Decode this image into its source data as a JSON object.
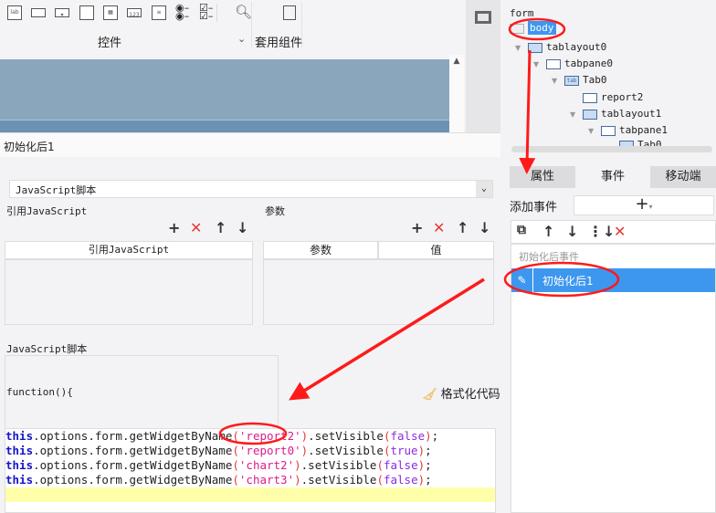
{
  "toolbar": {
    "group1_label": "控件",
    "group2_label": "套用组件",
    "icons": [
      "label-icon",
      "textbox-icon",
      "dropdown-icon",
      "panel-icon",
      "calendar-icon",
      "number-icon",
      "textarea-icon",
      "radio-group-icon",
      "checkbox-group-icon",
      "preview-icon",
      "layout-icon"
    ],
    "number_icon_text": "123",
    "label_icon_text": "lab"
  },
  "dialog": {
    "title": "初始化后1",
    "type_select": "JavaScript脚本",
    "ref_js": {
      "section_label": "引用JavaScript",
      "column": "引用JavaScript"
    },
    "params": {
      "section_label": "参数",
      "columns": [
        "参数",
        "值"
      ]
    },
    "script": {
      "section_label": "JavaScript脚本",
      "function_header": "function(){",
      "format_button": "格式化代码",
      "lines": [
        {
          "obj": "this",
          "mid": ".options.form.getWidgetByName",
          "arg": "'report2'",
          "method": ".setVisible",
          "val": "false"
        },
        {
          "obj": "this",
          "mid": ".options.form.getWidgetByName",
          "arg": "'report0'",
          "method": ".setVisible",
          "val": "true"
        },
        {
          "obj": "this",
          "mid": ".options.form.getWidgetByName",
          "arg": "'chart2'",
          "method": ".setVisible",
          "val": "false"
        },
        {
          "obj": "this",
          "mid": ".options.form.getWidgetByName",
          "arg": "'chart3'",
          "method": ".setVisible",
          "val": "false"
        }
      ]
    }
  },
  "tree": {
    "root": "form",
    "items": [
      "body",
      "tablayout0",
      "tabpane0",
      "Tab0",
      "report2",
      "tablayout1",
      "tabpane1",
      "Tab0"
    ],
    "tab_icon_text": "tab"
  },
  "right_tabs": [
    "属性",
    "事件",
    "移动端"
  ],
  "events": {
    "add_label": "添加事件",
    "group_label": "初始化后事件",
    "selected_item": "初始化后1"
  },
  "colors": {
    "selection": "#3d97ee",
    "annotation": "#ff1a1a"
  }
}
